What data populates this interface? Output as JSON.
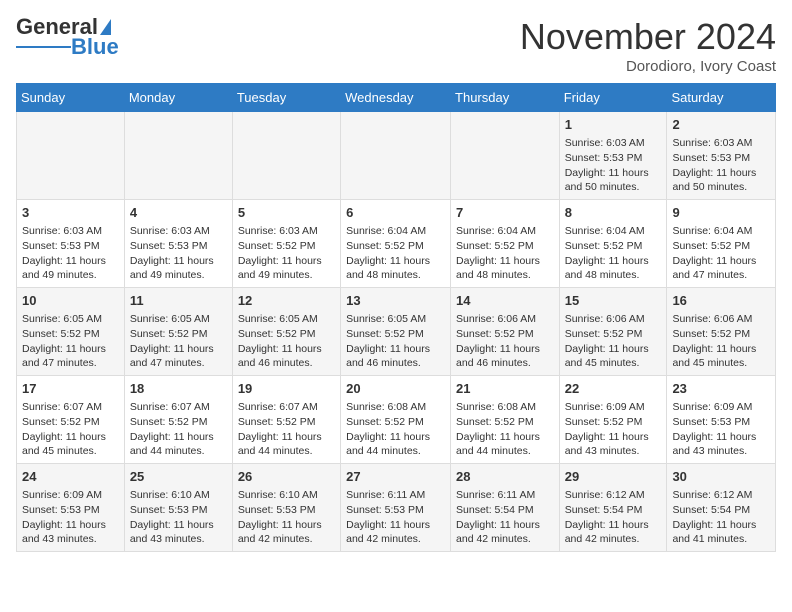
{
  "header": {
    "logo_line1": "General",
    "logo_line2": "Blue",
    "month": "November 2024",
    "location": "Dorodioro, Ivory Coast"
  },
  "days_of_week": [
    "Sunday",
    "Monday",
    "Tuesday",
    "Wednesday",
    "Thursday",
    "Friday",
    "Saturday"
  ],
  "weeks": [
    [
      {
        "day": null,
        "content": ""
      },
      {
        "day": null,
        "content": ""
      },
      {
        "day": null,
        "content": ""
      },
      {
        "day": null,
        "content": ""
      },
      {
        "day": null,
        "content": ""
      },
      {
        "day": "1",
        "sunrise": "Sunrise: 6:03 AM",
        "sunset": "Sunset: 5:53 PM",
        "daylight": "Daylight: 11 hours and 50 minutes."
      },
      {
        "day": "2",
        "sunrise": "Sunrise: 6:03 AM",
        "sunset": "Sunset: 5:53 PM",
        "daylight": "Daylight: 11 hours and 50 minutes."
      }
    ],
    [
      {
        "day": "3",
        "sunrise": "Sunrise: 6:03 AM",
        "sunset": "Sunset: 5:53 PM",
        "daylight": "Daylight: 11 hours and 49 minutes."
      },
      {
        "day": "4",
        "sunrise": "Sunrise: 6:03 AM",
        "sunset": "Sunset: 5:53 PM",
        "daylight": "Daylight: 11 hours and 49 minutes."
      },
      {
        "day": "5",
        "sunrise": "Sunrise: 6:03 AM",
        "sunset": "Sunset: 5:52 PM",
        "daylight": "Daylight: 11 hours and 49 minutes."
      },
      {
        "day": "6",
        "sunrise": "Sunrise: 6:04 AM",
        "sunset": "Sunset: 5:52 PM",
        "daylight": "Daylight: 11 hours and 48 minutes."
      },
      {
        "day": "7",
        "sunrise": "Sunrise: 6:04 AM",
        "sunset": "Sunset: 5:52 PM",
        "daylight": "Daylight: 11 hours and 48 minutes."
      },
      {
        "day": "8",
        "sunrise": "Sunrise: 6:04 AM",
        "sunset": "Sunset: 5:52 PM",
        "daylight": "Daylight: 11 hours and 48 minutes."
      },
      {
        "day": "9",
        "sunrise": "Sunrise: 6:04 AM",
        "sunset": "Sunset: 5:52 PM",
        "daylight": "Daylight: 11 hours and 47 minutes."
      }
    ],
    [
      {
        "day": "10",
        "sunrise": "Sunrise: 6:05 AM",
        "sunset": "Sunset: 5:52 PM",
        "daylight": "Daylight: 11 hours and 47 minutes."
      },
      {
        "day": "11",
        "sunrise": "Sunrise: 6:05 AM",
        "sunset": "Sunset: 5:52 PM",
        "daylight": "Daylight: 11 hours and 47 minutes."
      },
      {
        "day": "12",
        "sunrise": "Sunrise: 6:05 AM",
        "sunset": "Sunset: 5:52 PM",
        "daylight": "Daylight: 11 hours and 46 minutes."
      },
      {
        "day": "13",
        "sunrise": "Sunrise: 6:05 AM",
        "sunset": "Sunset: 5:52 PM",
        "daylight": "Daylight: 11 hours and 46 minutes."
      },
      {
        "day": "14",
        "sunrise": "Sunrise: 6:06 AM",
        "sunset": "Sunset: 5:52 PM",
        "daylight": "Daylight: 11 hours and 46 minutes."
      },
      {
        "day": "15",
        "sunrise": "Sunrise: 6:06 AM",
        "sunset": "Sunset: 5:52 PM",
        "daylight": "Daylight: 11 hours and 45 minutes."
      },
      {
        "day": "16",
        "sunrise": "Sunrise: 6:06 AM",
        "sunset": "Sunset: 5:52 PM",
        "daylight": "Daylight: 11 hours and 45 minutes."
      }
    ],
    [
      {
        "day": "17",
        "sunrise": "Sunrise: 6:07 AM",
        "sunset": "Sunset: 5:52 PM",
        "daylight": "Daylight: 11 hours and 45 minutes."
      },
      {
        "day": "18",
        "sunrise": "Sunrise: 6:07 AM",
        "sunset": "Sunset: 5:52 PM",
        "daylight": "Daylight: 11 hours and 44 minutes."
      },
      {
        "day": "19",
        "sunrise": "Sunrise: 6:07 AM",
        "sunset": "Sunset: 5:52 PM",
        "daylight": "Daylight: 11 hours and 44 minutes."
      },
      {
        "day": "20",
        "sunrise": "Sunrise: 6:08 AM",
        "sunset": "Sunset: 5:52 PM",
        "daylight": "Daylight: 11 hours and 44 minutes."
      },
      {
        "day": "21",
        "sunrise": "Sunrise: 6:08 AM",
        "sunset": "Sunset: 5:52 PM",
        "daylight": "Daylight: 11 hours and 44 minutes."
      },
      {
        "day": "22",
        "sunrise": "Sunrise: 6:09 AM",
        "sunset": "Sunset: 5:52 PM",
        "daylight": "Daylight: 11 hours and 43 minutes."
      },
      {
        "day": "23",
        "sunrise": "Sunrise: 6:09 AM",
        "sunset": "Sunset: 5:53 PM",
        "daylight": "Daylight: 11 hours and 43 minutes."
      }
    ],
    [
      {
        "day": "24",
        "sunrise": "Sunrise: 6:09 AM",
        "sunset": "Sunset: 5:53 PM",
        "daylight": "Daylight: 11 hours and 43 minutes."
      },
      {
        "day": "25",
        "sunrise": "Sunrise: 6:10 AM",
        "sunset": "Sunset: 5:53 PM",
        "daylight": "Daylight: 11 hours and 43 minutes."
      },
      {
        "day": "26",
        "sunrise": "Sunrise: 6:10 AM",
        "sunset": "Sunset: 5:53 PM",
        "daylight": "Daylight: 11 hours and 42 minutes."
      },
      {
        "day": "27",
        "sunrise": "Sunrise: 6:11 AM",
        "sunset": "Sunset: 5:53 PM",
        "daylight": "Daylight: 11 hours and 42 minutes."
      },
      {
        "day": "28",
        "sunrise": "Sunrise: 6:11 AM",
        "sunset": "Sunset: 5:54 PM",
        "daylight": "Daylight: 11 hours and 42 minutes."
      },
      {
        "day": "29",
        "sunrise": "Sunrise: 6:12 AM",
        "sunset": "Sunset: 5:54 PM",
        "daylight": "Daylight: 11 hours and 42 minutes."
      },
      {
        "day": "30",
        "sunrise": "Sunrise: 6:12 AM",
        "sunset": "Sunset: 5:54 PM",
        "daylight": "Daylight: 11 hours and 41 minutes."
      }
    ]
  ]
}
